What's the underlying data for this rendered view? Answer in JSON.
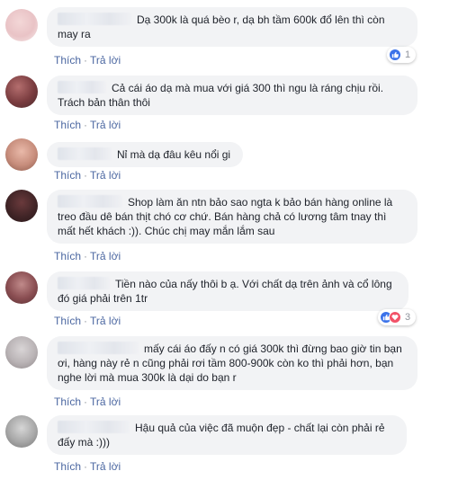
{
  "actions": {
    "like": "Thích",
    "reply": "Trả lời",
    "separator": "·"
  },
  "comments": [
    {
      "text": "Dạ 300k là quá bèo r, dạ bh tầm 600k đổ lên thì còn may ra",
      "reaction_count": "1",
      "reactions": [
        "like-icon"
      ]
    },
    {
      "text": "Cả cái áo dạ mà mua với giá 300 thì ngu là ráng chịu rồi. Trách bản thân thôi"
    },
    {
      "text": "Nỉ mà dạ đâu kêu nổi gi"
    },
    {
      "text": "Shop làm ăn ntn bảo sao ngta k bảo bán hàng online là treo đầu dê bán thịt chó cơ chứ. Bán hàng chả có lương tâm tnay thì mất hết khách :)). Chúc chị may mắn lắm sau"
    },
    {
      "text": "Tiền nào của nấy thôi b ạ. Với chất dạ trên ảnh và cổ lông đó giá phải trên 1tr",
      "reaction_count": "3",
      "reactions": [
        "like-icon",
        "heart-icon"
      ]
    },
    {
      "text": "mấy cái áo đấy n có giá 300k thì đừng bao giờ tin bạn ơi, hàng này rẻ n cũng phải rơi tầm 800-900k còn ko thì phải hơn, bạn nghe lời mà mua 300k là dại do bạn r"
    },
    {
      "text": "Hậu quả của việc đã muộn đẹp - chất lại còn phải rẻ đấy mà :)))"
    }
  ],
  "colors": {
    "bubble": "#f2f3f5",
    "link": "#4b67a1",
    "like": "#3b72e9",
    "heart": "#f25268"
  }
}
